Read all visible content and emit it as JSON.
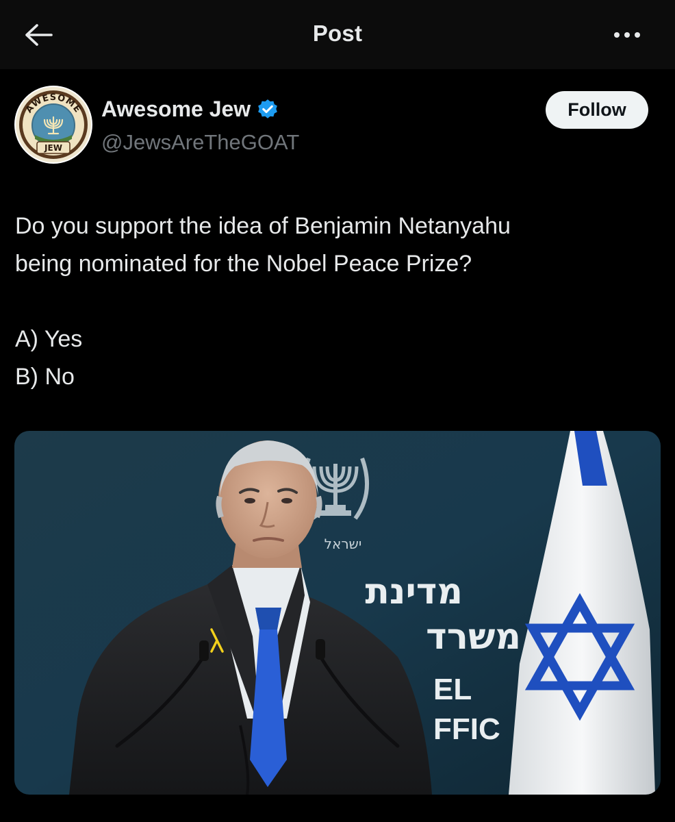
{
  "header": {
    "title": "Post"
  },
  "author": {
    "name": "Awesome Jew",
    "handle": "@JewsAreTheGOAT",
    "avatar_text_top": "AWESOME",
    "avatar_text_bottom": "JEW",
    "verified_color": "#1d9bf0"
  },
  "follow_label": "Follow",
  "post": {
    "line1": "Do you support the idea of Benjamin Netanyahu",
    "line2": "being nominated for the Nobel Peace Prize?",
    "option_a": "A) Yes",
    "option_b": "B) No"
  },
  "media": {
    "backdrop_hebrew_1": "מדינת",
    "backdrop_hebrew_2": "משרד",
    "backdrop_text_1": "EL",
    "backdrop_text_2": "FFIC",
    "seal_text": "ישראל"
  }
}
